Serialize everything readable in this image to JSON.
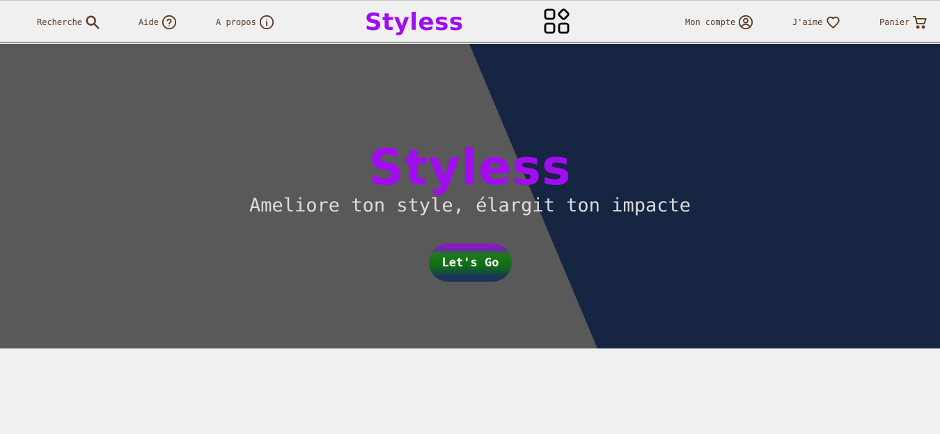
{
  "nav": {
    "search_label": "Recherche",
    "help_label": "Aide",
    "about_label": "A propos",
    "brand": "Styless",
    "account_label": "Mon compte",
    "likes_label": "J'aime",
    "cart_label": "Panier",
    "icons": {
      "search": "search-icon",
      "help": "help-circle-icon",
      "about": "info-circle-icon",
      "apps": "apps-grid-icon",
      "account": "user-circle-icon",
      "likes": "heart-icon",
      "cart": "cart-icon"
    }
  },
  "hero": {
    "title": "Styless",
    "subtitle": "Ameliore ton style, élargit ton impacte",
    "cta_label": "Let's Go"
  },
  "colors": {
    "brand": "#a10cf0",
    "nav_text": "#5b3a22",
    "hero_left": "#595959",
    "hero_right": "#152542",
    "page_bg": "#f0f0f0"
  }
}
